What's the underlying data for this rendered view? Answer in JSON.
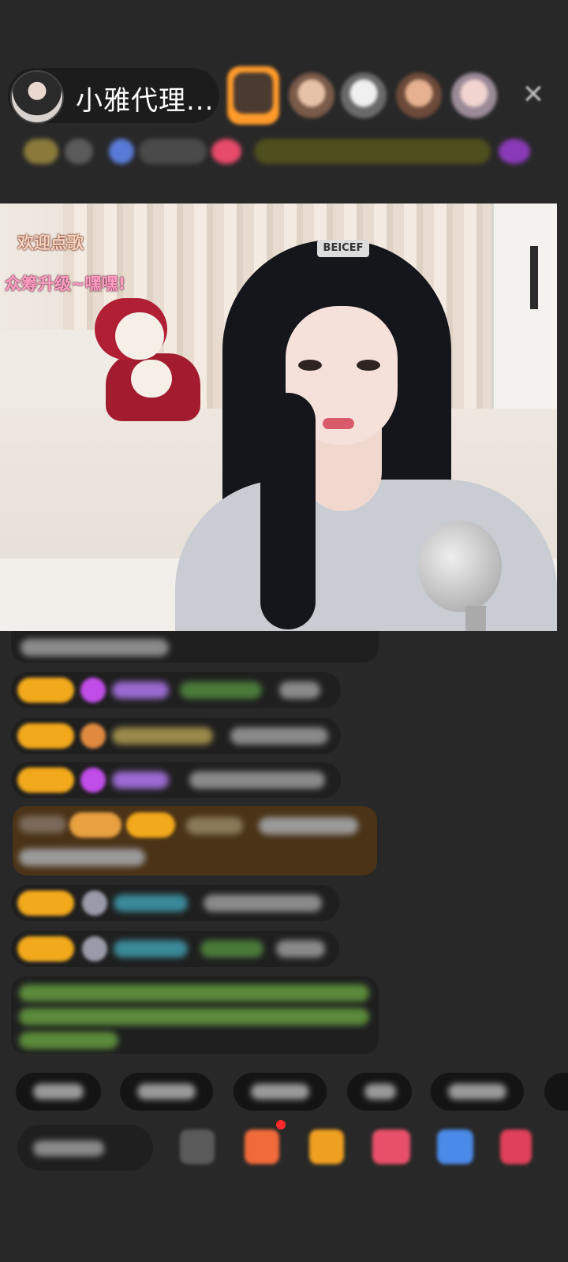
{
  "header": {
    "host_name": "小雅代理...",
    "viewers": [
      "top-viewer-1",
      "viewer-2",
      "viewer-3",
      "viewer-4",
      "viewer-5"
    ],
    "close_icon": "close-icon"
  },
  "video": {
    "overlay_line_1": "欢迎点歌",
    "overlay_line_2": "众筹升级~嘿嘿!",
    "hairclip_text": "BEICEF"
  },
  "colors": {
    "badge": "#f2a91b",
    "gem": "#c04de8",
    "highlight_row": "#4a3317",
    "system_text": "#6aa03a"
  }
}
